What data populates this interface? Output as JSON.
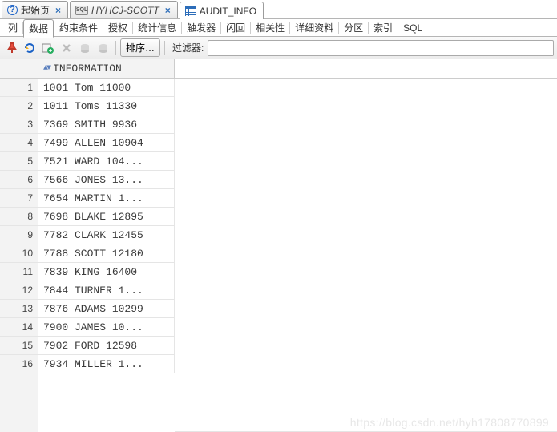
{
  "tabs": [
    {
      "icon": "help-icon",
      "label": "起始页",
      "closable": true,
      "active": false
    },
    {
      "icon": "sql-icon",
      "label": "HYHCJ-SCOTT",
      "closable": true,
      "active": false,
      "italic": true
    },
    {
      "icon": "table-icon",
      "label": "AUDIT_INFO",
      "closable": false,
      "active": true
    }
  ],
  "subtabs": {
    "items": [
      "列",
      "数据",
      "约束条件",
      "授权",
      "统计信息",
      "触发器",
      "闪回",
      "相关性",
      "详细资料",
      "分区",
      "索引",
      "SQL"
    ],
    "active_index": 1
  },
  "toolbar": {
    "pin": "pin-icon",
    "refresh": "refresh-icon",
    "add": "add-row-icon",
    "delete": "delete-row-icon",
    "db1": "db-up-icon",
    "db2": "db-down-icon",
    "sort_label": "排序…",
    "filter_label": "过滤器:",
    "filter_value": ""
  },
  "grid": {
    "column_header": "INFORMATION",
    "rows": [
      {
        "n": 1,
        "v": "1001 Tom 11000"
      },
      {
        "n": 2,
        "v": "1011 Toms 11330"
      },
      {
        "n": 3,
        "v": "7369 SMITH 9936"
      },
      {
        "n": 4,
        "v": "7499 ALLEN 10904"
      },
      {
        "n": 5,
        "v": "7521 WARD 104..."
      },
      {
        "n": 6,
        "v": "7566 JONES 13..."
      },
      {
        "n": 7,
        "v": "7654 MARTIN 1..."
      },
      {
        "n": 8,
        "v": "7698 BLAKE 12895"
      },
      {
        "n": 9,
        "v": "7782 CLARK 12455"
      },
      {
        "n": 10,
        "v": "7788 SCOTT 12180"
      },
      {
        "n": 11,
        "v": "7839 KING 16400"
      },
      {
        "n": 12,
        "v": "7844 TURNER 1..."
      },
      {
        "n": 13,
        "v": "7876 ADAMS 10299"
      },
      {
        "n": 14,
        "v": "7900 JAMES 10..."
      },
      {
        "n": 15,
        "v": "7902 FORD 12598"
      },
      {
        "n": 16,
        "v": "7934 MILLER 1..."
      }
    ]
  },
  "watermark": "https://blog.csdn.net/hyh17808770899"
}
